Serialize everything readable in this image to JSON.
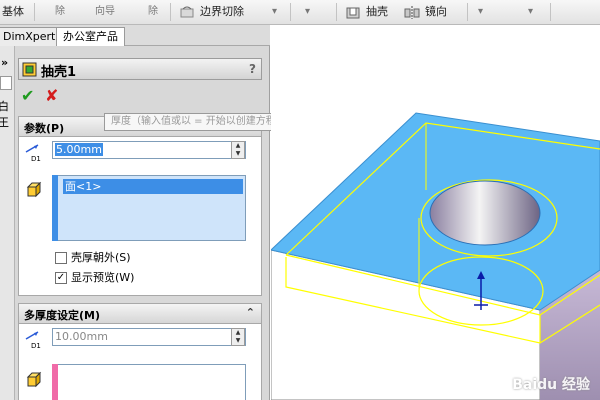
{
  "toolbar": {
    "items": [
      "基体",
      "除",
      "向导",
      "除",
      "边界切除",
      "抽壳",
      "镜向"
    ]
  },
  "tabs": [
    "DimXpert",
    "办公室产品"
  ],
  "left_strip": {
    "chevrons": "»",
    "clipped_text": "白王"
  },
  "feature": {
    "title": "抽壳1",
    "help": "?",
    "ok": "✔",
    "cancel": "✘"
  },
  "params": {
    "title": "参数(P)",
    "thickness": "5.00mm",
    "dim_label": "D1",
    "faces": [
      "面<1>"
    ],
    "shell_outward": {
      "label": "壳厚朝外(S)",
      "checked": false
    },
    "show_preview": {
      "label": "显示预览(W)",
      "checked": true
    }
  },
  "tooltip": "厚度（输入值或以 = 开始以创建方程式）",
  "multi": {
    "title": "多厚度设定(M)",
    "thickness": "10.00mm",
    "dim_label": "D1"
  },
  "watermark": "Baidu 经验",
  "colors": {
    "top_face": "#5bb8f5",
    "selection": "#ffff00",
    "side_face": "#b6a6c4"
  }
}
